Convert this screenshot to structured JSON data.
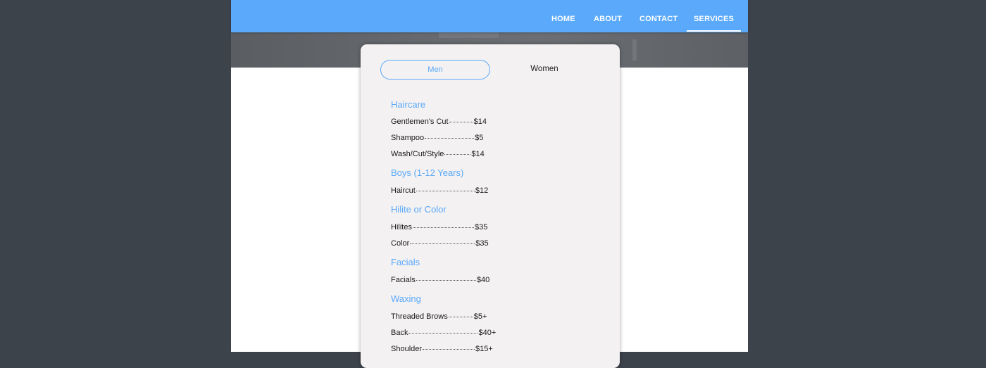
{
  "nav": {
    "items": [
      {
        "label": "HOME",
        "active": false
      },
      {
        "label": "ABOUT",
        "active": false
      },
      {
        "label": "CONTACT",
        "active": false
      },
      {
        "label": "SERVICES",
        "active": true
      }
    ]
  },
  "services": {
    "tabs": [
      {
        "label": "Men",
        "selected": true
      },
      {
        "label": "Women",
        "selected": false
      }
    ],
    "sections": [
      {
        "title": "Haircare",
        "items": [
          {
            "name": "Gentlemen's Cut",
            "price": "$14"
          },
          {
            "name": "Shampoo",
            "price": "$5"
          },
          {
            "name": "Wash/Cut/Style",
            "price": "$14"
          }
        ]
      },
      {
        "title": "Boys (1-12 Years)",
        "items": [
          {
            "name": "Haircut",
            "price": "$12"
          }
        ]
      },
      {
        "title": "Hilite or Color",
        "items": [
          {
            "name": "Hilites",
            "price": "$35"
          },
          {
            "name": "Color",
            "price": "$35"
          }
        ]
      },
      {
        "title": "Facials",
        "items": [
          {
            "name": "Facials",
            "price": "$40"
          }
        ]
      },
      {
        "title": "Waxing",
        "items": [
          {
            "name": "Threaded Brows",
            "price": "$5+"
          },
          {
            "name": "Back",
            "price": "$40+"
          },
          {
            "name": "Shoulder",
            "price": "$15+"
          }
        ]
      }
    ]
  },
  "colors": {
    "accent": "#5aa9fa",
    "outer_background": "#3d434b",
    "card_background": "#f3f1f1"
  }
}
